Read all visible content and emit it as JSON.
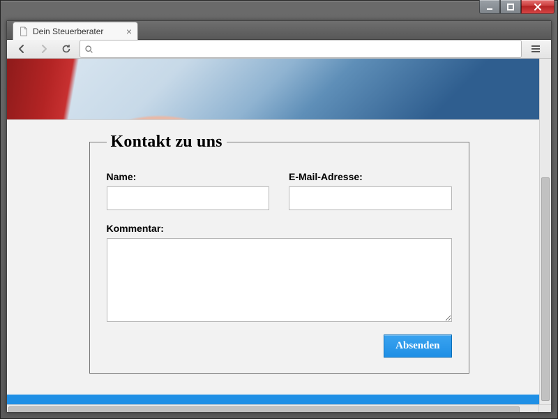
{
  "window": {
    "tab_title": "Dein Steuerberater"
  },
  "form": {
    "legend": "Kontakt zu uns",
    "name_label": "Name:",
    "email_label": "E-Mail-Adresse:",
    "comment_label": "Kommentar:",
    "name_value": "",
    "email_value": "",
    "comment_value": "",
    "submit_label": "Absenden"
  }
}
